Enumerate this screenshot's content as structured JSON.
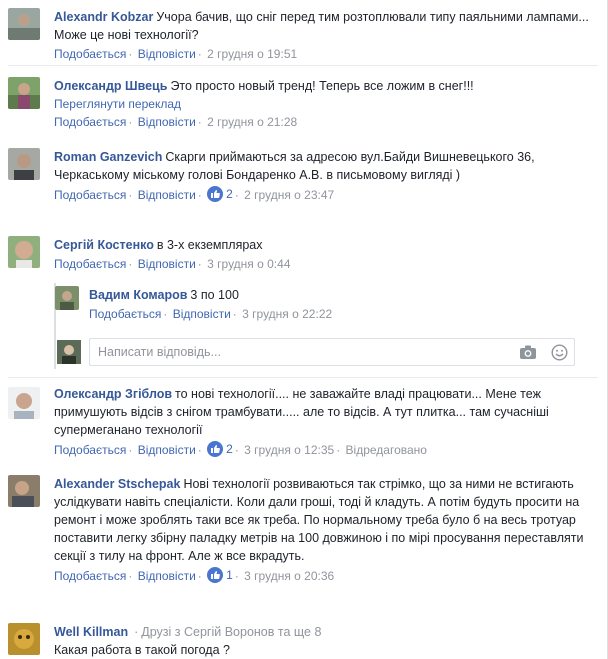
{
  "common": {
    "like": "Подобається",
    "reply": "Відповісти",
    "dot": "·"
  },
  "comments": [
    {
      "author": "Alexandr Kobzar",
      "text": "Учора бачив, що сніг перед тим розтоплювали типу паяльними лампами... Може це нові технології?",
      "time": "2 грудня о 19:51"
    },
    {
      "author": "Олександр Швець",
      "text": "Это просто новый тренд! Теперь все ложим в снег!!!",
      "translate": "Переглянути переклад",
      "time": "2 грудня о 21:28"
    },
    {
      "author": "Roman Ganzevich",
      "text": "Скарги приймаються за адресою вул.Байди Вишневецького 36, Черкаському міському голові Бондаренко А.В. в письмовому вигляді )",
      "likes": "2",
      "time": "2 грудня о 23:47"
    },
    {
      "author": "Сергій Костенко",
      "text": "в 3-х екземплярах",
      "time": "3 грудня о 0:44"
    },
    {
      "author": "Вадим Комаров",
      "text": "3 по 100",
      "time": "3 грудня о 22:22"
    },
    {
      "author": "Олександр Згіблов",
      "text": "то нові технології.... не заважайте владі працювати... Мене теж примушують відсів з снігом трамбувати..... але то відсів. А тут плитка... там сучасніші супермегананo технології",
      "likes": "2",
      "time": "3 грудня о 12:35",
      "edited": "Відредаговано"
    },
    {
      "author": "Alexander Stschepak",
      "text": "Нові технології розвиваються так стрімко, що за ними не встигають услідкувати навіть спеціалісти. Коли дали гроші, тоді й кладуть. А потім будуть просити на ремонт і може зроблять таки все як треба. По нормальному треба було б на весь тротуар поставити легку збірну паладку метрів на 100 довжиною і по мірі просування переставляти секції з тилу на фронт. Але ж все вкрадуть.",
      "likes": "1",
      "time": "3 грудня о 20:36"
    },
    {
      "author": "Well Killman",
      "friends": "Друзі з Сергій Воронов та ще 8",
      "text": "Какая работа в такой погода ?"
    }
  ],
  "reply_input": {
    "placeholder": "Написати відповідь..."
  },
  "colors": {
    "link": "#365899",
    "action": "#4267b2",
    "meta": "#90949c",
    "like_badge": "#4a76d2"
  }
}
